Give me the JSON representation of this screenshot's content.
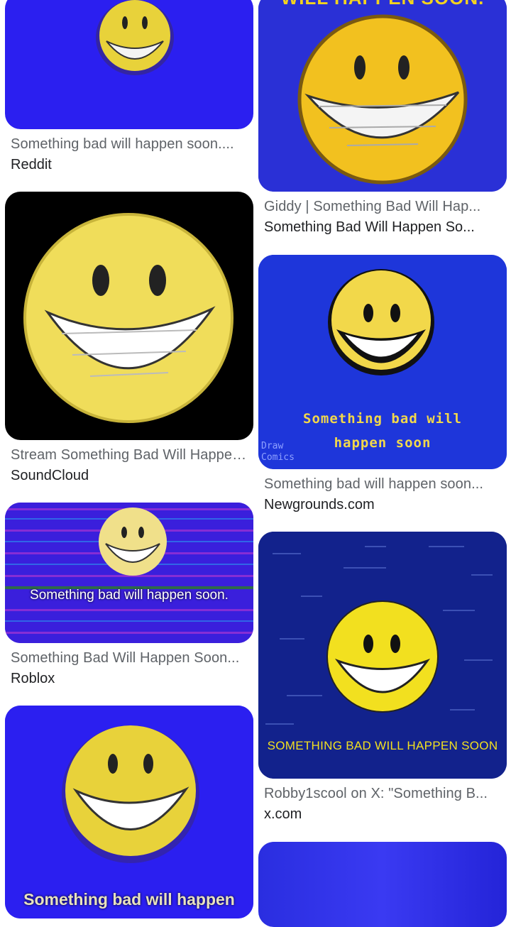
{
  "results": {
    "left": [
      {
        "title": "Something bad will happen soon....",
        "source": "Reddit"
      },
      {
        "title": "Stream Something Bad Will Happen...",
        "source": "SoundCloud"
      },
      {
        "title": "Something Bad Will Happen Soon...",
        "source": "Roblox",
        "caption": "Something bad will happen soon."
      },
      {
        "caption": "Something bad will happen"
      }
    ],
    "right": [
      {
        "title": "Giddy | Something Bad Will Hap...",
        "source": "Something Bad Will Happen So...",
        "caption": "WILL HAPPEN SOON."
      },
      {
        "title": "Something bad will happen soon...",
        "source": "Newgrounds.com",
        "caption_line1": "Something bad will",
        "caption_line2": "happen soon",
        "watermark": "Draw Comics"
      },
      {
        "title": "Robby1scool on X: \"Something B...",
        "source": "x.com",
        "caption": "SOMETHING BAD WILL HAPPEN SOON"
      },
      {}
    ]
  }
}
